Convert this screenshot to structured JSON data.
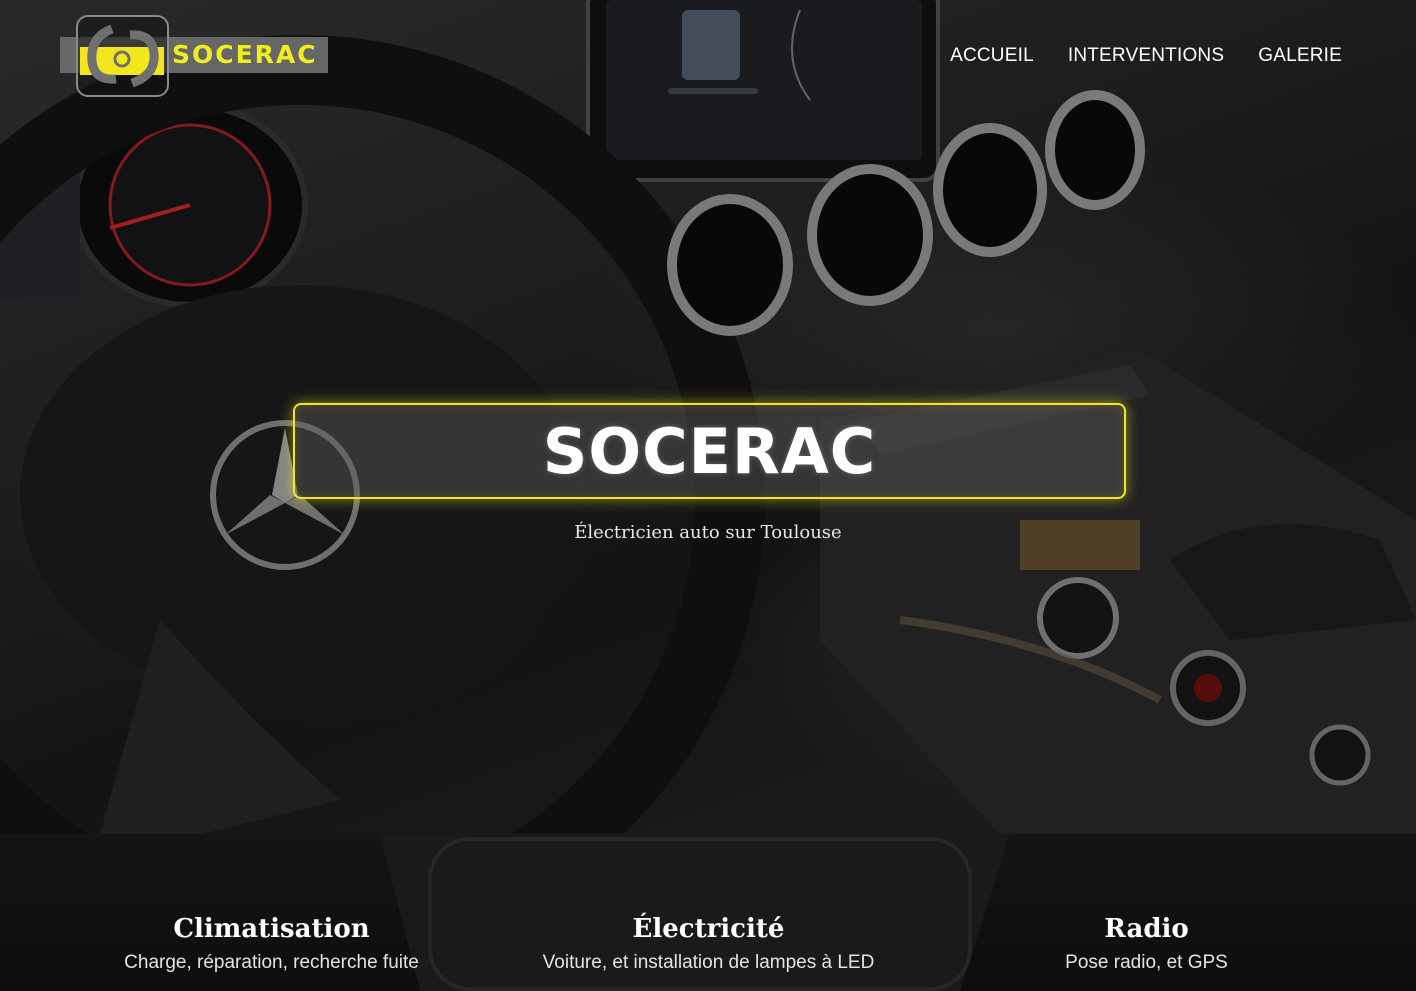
{
  "brand": {
    "name": "SOCERAC",
    "accent": "#f4e61c"
  },
  "nav": [
    {
      "label": "ACCUEIL"
    },
    {
      "label": "INTERVENTIONS"
    },
    {
      "label": "GALERIE"
    }
  ],
  "hero": {
    "title": "SOCERAC",
    "subtitle": "Électricien auto sur Toulouse"
  },
  "services": [
    {
      "title": "Climatisation",
      "description": "Charge, réparation, recherche fuite"
    },
    {
      "title": "Électricité",
      "description": "Voiture, et installation de lampes à LED"
    },
    {
      "title": "Radio",
      "description": "Pose radio, et GPS"
    }
  ]
}
